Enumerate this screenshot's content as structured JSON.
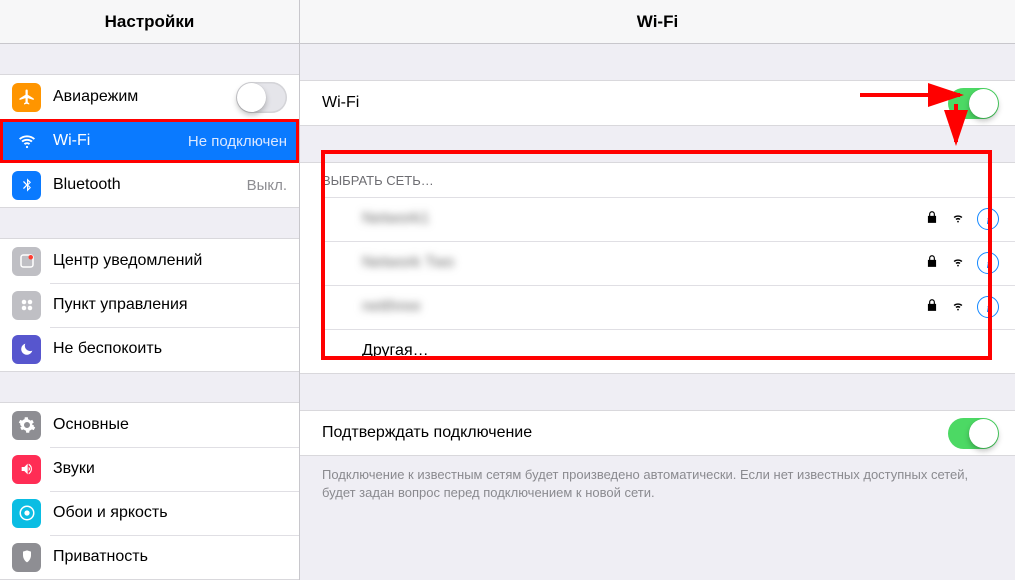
{
  "sidebar": {
    "title": "Настройки",
    "group1": [
      {
        "name": "airplane-mode",
        "label": "Авиарежим",
        "toggle": false
      },
      {
        "name": "wifi",
        "label": "Wi-Fi",
        "detail": "Не подключен",
        "selected": true
      },
      {
        "name": "bluetooth",
        "label": "Bluetooth",
        "detail": "Выкл."
      }
    ],
    "group2": [
      {
        "name": "notification-center",
        "label": "Центр уведомлений"
      },
      {
        "name": "control-center",
        "label": "Пункт управления"
      },
      {
        "name": "do-not-disturb",
        "label": "Не беспокоить"
      }
    ],
    "group3": [
      {
        "name": "general",
        "label": "Основные"
      },
      {
        "name": "sounds",
        "label": "Звуки"
      },
      {
        "name": "wallpaper-brightness",
        "label": "Обои и яркость"
      },
      {
        "name": "privacy",
        "label": "Приватность"
      }
    ]
  },
  "main": {
    "title": "Wi-Fi",
    "wifi_row_label": "Wi-Fi",
    "wifi_on": true,
    "choose_network_header": "ВЫБРАТЬ СЕТЬ…",
    "networks": [
      {
        "name": "Network1",
        "locked": true
      },
      {
        "name": "Network Two",
        "locked": true
      },
      {
        "name": "netthree",
        "locked": true
      }
    ],
    "other_label": "Другая…",
    "ask_to_join_label": "Подтверждать подключение",
    "ask_to_join_on": true,
    "ask_footer": "Подключение к известным сетям будет произведено автоматически. Если нет известных доступных сетей, будет задан вопрос перед подключением к новой сети."
  }
}
